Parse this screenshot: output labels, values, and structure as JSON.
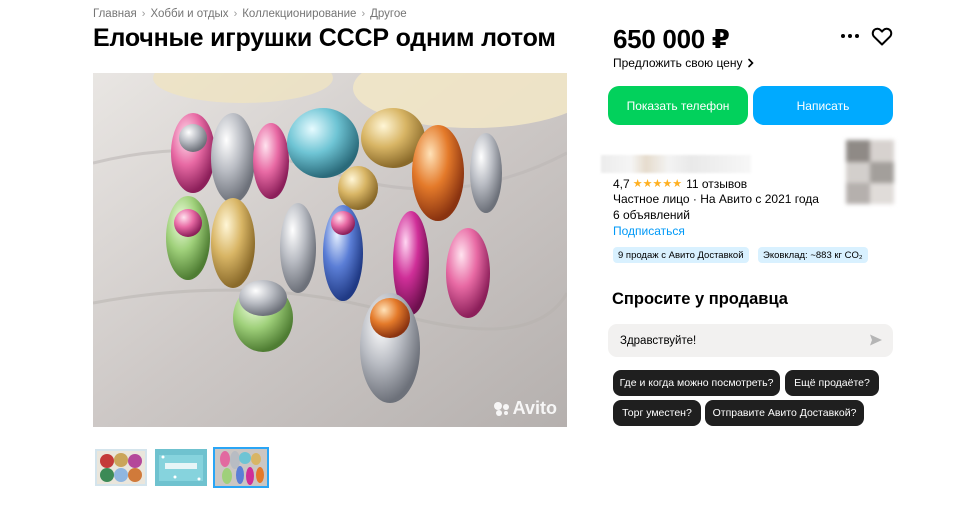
{
  "breadcrumbs": [
    {
      "label": "Главная"
    },
    {
      "label": "Хобби и отдых"
    },
    {
      "label": "Коллекционирование"
    },
    {
      "label": "Другое"
    }
  ],
  "listing": {
    "title": "Елочные игрушки СССР одним лотом",
    "price": "650 000 ₽",
    "offer_label": "Предложить свою цену",
    "watermark": "Avito",
    "photo_count": 3,
    "active_photo": 3
  },
  "actions": {
    "show_phone": "Показать телефон",
    "write": "Написать"
  },
  "seller": {
    "rating": "4,7",
    "rating_stars": 4.7,
    "reviews": "11 отзывов",
    "type": "Частное лицо · На Авито с 2021 года",
    "ads_count": "6 объявлений",
    "subscribe": "Подписаться",
    "badges": {
      "delivery": "9 продаж с Авито Доставкой",
      "eco": "Эковклад: ~883 кг CO₂"
    }
  },
  "chat": {
    "heading": "Спросите у продавца",
    "input_value": "Здравствуйте!",
    "quick_questions": [
      "Где и когда можно посмотреть?",
      "Ещё продаёте?",
      "Торг уместен?",
      "Отправите Авито Доставкой?"
    ]
  },
  "colors": {
    "phone_button": "#02d15c",
    "write_button": "#00aaff",
    "link": "#0099f7",
    "badge_bg": "#d9f1ff",
    "star": "#ffb021",
    "chip_bg": "#1f1f1f"
  },
  "icons": {
    "more": "more-dots-icon",
    "favorite": "heart-icon",
    "offer_chevron": "chevron-right-icon",
    "send": "send-icon",
    "star": "star-icon"
  }
}
